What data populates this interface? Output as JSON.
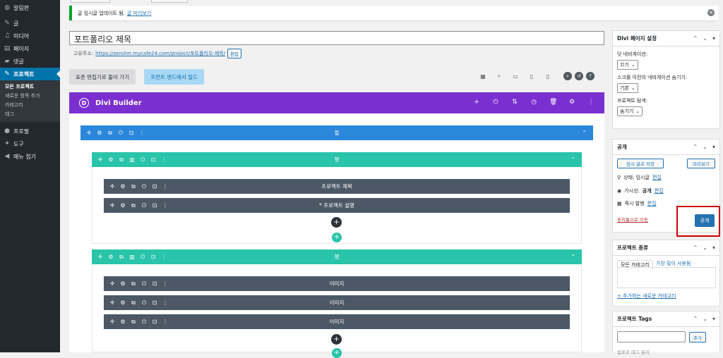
{
  "sidebar": {
    "items": [
      {
        "label": "알림판",
        "icon": "dashboard-icon",
        "glyph": "◍"
      },
      {
        "label": "글",
        "icon": "pin-icon",
        "glyph": "📌"
      },
      {
        "label": "미디어",
        "icon": "media-icon",
        "glyph": "🎵"
      },
      {
        "label": "페이지",
        "icon": "page-icon",
        "glyph": "▤"
      },
      {
        "label": "댓글",
        "icon": "comment-icon",
        "glyph": "▰"
      },
      {
        "label": "프로젝트",
        "icon": "pin-icon",
        "glyph": "📌",
        "active": true
      }
    ],
    "submenu": [
      "모든 프로젝트",
      "새로운 항목 추가",
      "카테고리",
      "태그"
    ],
    "items_after": [
      {
        "label": "프로필",
        "icon": "user-icon",
        "glyph": "👤"
      },
      {
        "label": "도구",
        "icon": "wrench-icon",
        "glyph": "🔧"
      },
      {
        "label": "메뉴 접기",
        "icon": "collapse-icon",
        "glyph": "◀"
      }
    ]
  },
  "notice": {
    "text": "글 임시글 업데이트 됨.",
    "link": "글 미리보기"
  },
  "editor": {
    "title": "포트폴리오 제목",
    "permalink_label": "고유주소:",
    "permalink_url": "https://zerolim.mycafe24.com/project/포트폴리오-제목/",
    "permalink_edit": "편집",
    "back_button": "표준 편집기로 돌아 가기",
    "frontend_button": "프런트 엔드에서 빌드"
  },
  "divi": {
    "logo": "D",
    "title": "Divi Builder",
    "section_label": "절",
    "row1_label": "행",
    "row1_modules": [
      "프로젝트 제목",
      "* 프로젝트 설명"
    ],
    "row2_label": "행",
    "row2_modules": [
      "이미지",
      "이미지",
      "이미지"
    ]
  },
  "divi_settings": {
    "title": "Divi 페이지 설정",
    "dot_nav_label": "닷 네비게이션:",
    "dot_nav_value": "끄기",
    "hide_nav_label": "스크롤 이전의 네비게이션 숨기기:",
    "hide_nav_value": "기본",
    "project_nav_label": "프로젝트 탐색:",
    "project_nav_value": "숨기기"
  },
  "publish": {
    "title": "공개",
    "save_draft": "임시 글로 저장",
    "preview": "미리보기",
    "status_label": "상태: 임시글",
    "visibility_label": "가시성:",
    "visibility_value": "공개",
    "schedule_label": "즉시 발행",
    "edit": "편집",
    "trash": "휴지통으로 이동",
    "publish_button": "공개"
  },
  "project_category": {
    "title": "프로젝트 종류",
    "tab_all": "모든 카테고리",
    "tab_popular": "가장 많이 사용됨",
    "add_new": "+ 추가하는 새로운 카테고리"
  },
  "project_tags": {
    "title": "프로젝트 Tags",
    "add_button": "추가",
    "separator_hint": "쉼표로 태그 분리"
  }
}
